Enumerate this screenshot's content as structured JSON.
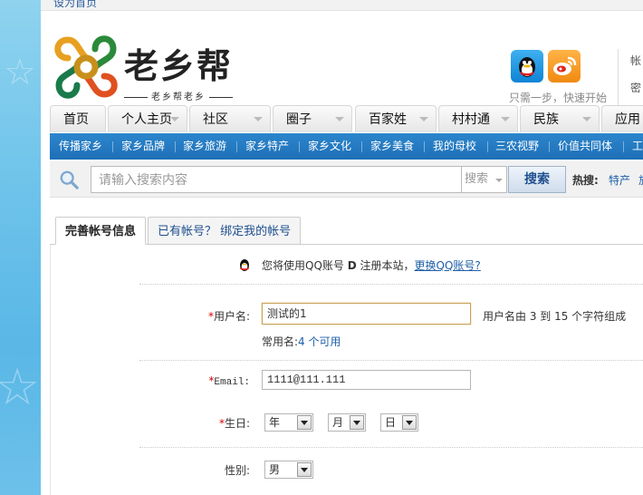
{
  "topbar": {
    "set_home": "设为首页"
  },
  "header": {
    "logo_text": "老乡帮",
    "logo_slogan": "老乡帮老乡",
    "social_text": "只需一步，快速开始",
    "account_label": "帐",
    "password_label": "密"
  },
  "mainnav": [
    "首页",
    "个人主页",
    "社区",
    "圈子",
    "百家姓",
    "村村通",
    "民族",
    "应用"
  ],
  "subnav": [
    "传播家乡",
    "家乡品牌",
    "家乡旅游",
    "家乡特产",
    "家乡文化",
    "家乡美食",
    "我的母校",
    "三农视野",
    "价值共同体",
    "工"
  ],
  "search": {
    "placeholder": "请输入搜索内容",
    "type_selected": "搜索",
    "button": "搜索",
    "hot_label": "热搜:",
    "hot_items": [
      "特产",
      "旅"
    ]
  },
  "content_tabs": [
    "完善帐号信息",
    "已有帐号？ 绑定我的帐号"
  ],
  "notice": {
    "text_before": "您将使用QQ账号 ",
    "account": "D",
    "text_after": " 注册本站，",
    "link": "更换QQ账号?"
  },
  "form": {
    "username_label": "用户名:",
    "username_value": "测试的1",
    "username_hint": "用户名由 3 到 15 个字符组成",
    "common_name_prefix": "常用名:",
    "common_name_link": "4 个可用",
    "email_label": "Email:",
    "email_value": "1111@111.111",
    "birthday_label": "生日:",
    "year": "年",
    "month": "月",
    "day": "日",
    "gender_label": "性别:",
    "gender": "男",
    "required_mark": "*"
  },
  "colors": {
    "nav_blue": "#1e6fb7",
    "link_blue": "#1e5fa8",
    "required_red": "#dd0000"
  }
}
